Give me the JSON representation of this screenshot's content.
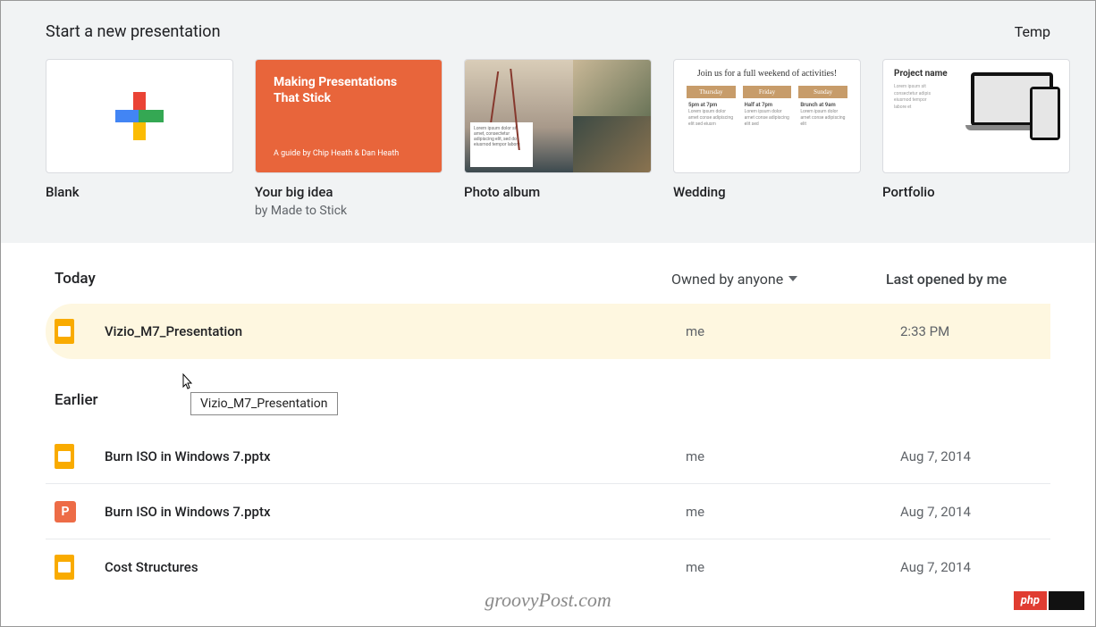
{
  "templates": {
    "section_title": "Start a new presentation",
    "gallery_link": "Temp",
    "items": [
      {
        "name": "Blank",
        "subtitle": ""
      },
      {
        "name": "Your big idea",
        "subtitle": "by Made to Stick",
        "thumb_title": "Making Presentations That Stick",
        "thumb_sub": "A guide by Chip Heath & Dan Heath"
      },
      {
        "name": "Photo album",
        "subtitle": ""
      },
      {
        "name": "Wedding",
        "subtitle": "",
        "thumb_title": "Join us for a full weekend of activities!",
        "cols": [
          "Thursday",
          "Friday",
          "Sunday"
        ]
      },
      {
        "name": "Portfolio",
        "subtitle": "",
        "thumb_title": "Project name"
      }
    ]
  },
  "list": {
    "owner_filter": "Owned by anyone",
    "sort_label": "Last opened by me",
    "groups": [
      {
        "label": "Today",
        "rows": [
          {
            "icon": "slides",
            "name": "Vizio_M7_Presentation",
            "owner": "me",
            "date": "2:33 PM",
            "highlighted": true
          }
        ]
      },
      {
        "label": "Earlier",
        "rows": [
          {
            "icon": "slides",
            "name": "Burn ISO in Windows 7.pptx",
            "owner": "me",
            "date": "Aug 7, 2014"
          },
          {
            "icon": "ppt",
            "name": "Burn ISO in Windows 7.pptx",
            "owner": "me",
            "date": "Aug 7, 2014"
          },
          {
            "icon": "slides",
            "name": "Cost Structures",
            "owner": "me",
            "date": "Aug 7, 2014"
          }
        ]
      }
    ]
  },
  "tooltip": "Vizio_M7_Presentation",
  "watermark": "groovyPost.com",
  "php_label": "php"
}
